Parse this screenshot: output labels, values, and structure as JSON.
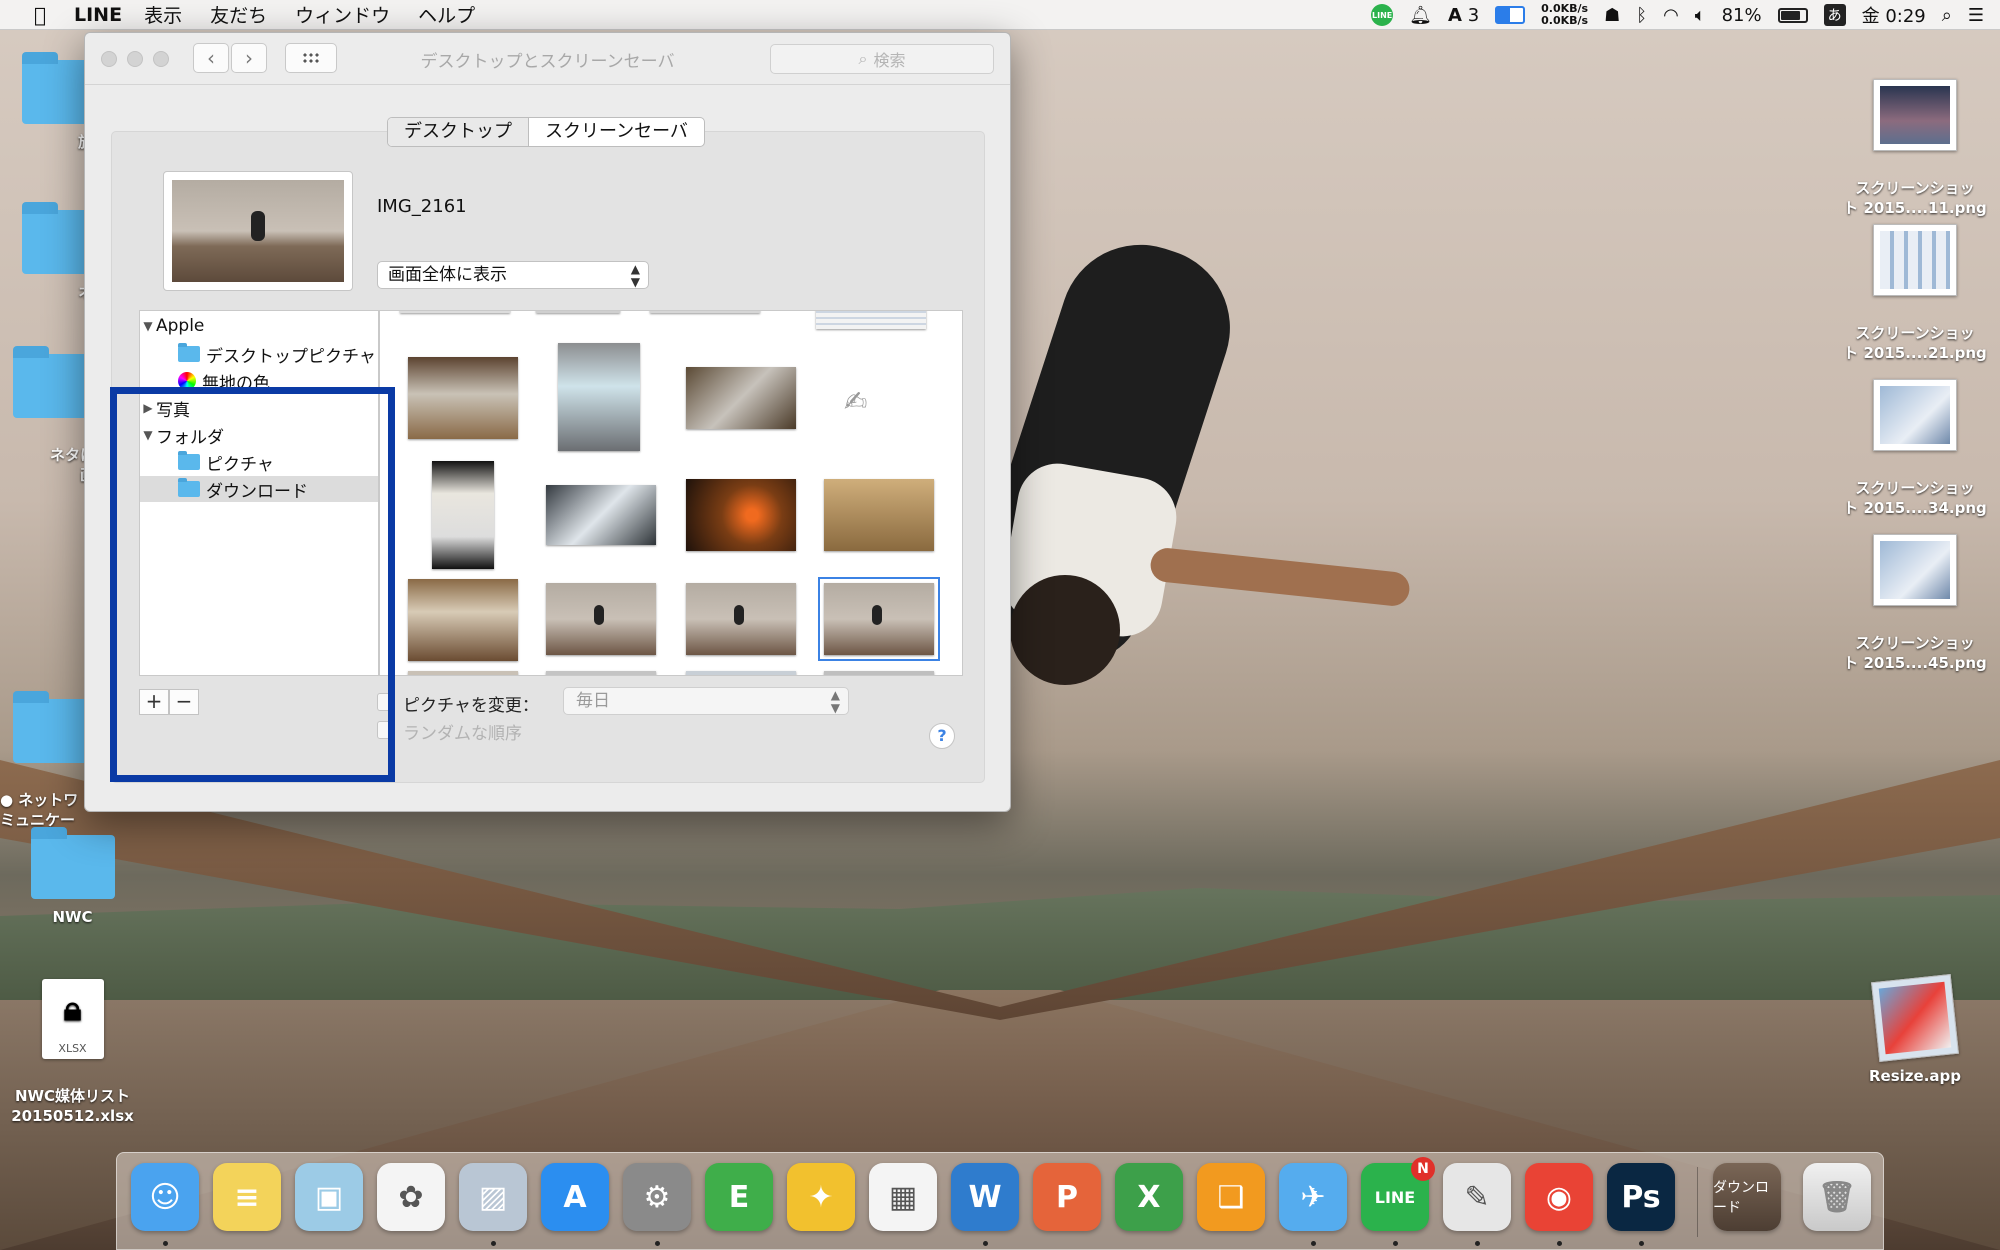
{
  "menubar": {
    "app_name": "LINE",
    "menus": [
      "表示",
      "友だち",
      "ウィンドウ",
      "ヘルプ"
    ],
    "status": {
      "line_icon_text": "LINE",
      "adobe_count": "3",
      "net_up": "0.0KB/s",
      "net_down": "0.0KB/s",
      "battery_percent": "81%",
      "battery_level": 0.81,
      "ime": "あ",
      "clock": "金 0:29"
    }
  },
  "desktop_left": [
    {
      "label": "旅ガ"
    },
    {
      "label": "オク"
    },
    {
      "label": "ネタにな\n画像"
    },
    {
      "label": "● ネットワ\nミュニケー"
    },
    {
      "label": "NWC"
    },
    {
      "label": "NWC媒体リスト\n20150512.xlsx",
      "ext": "XLSX"
    }
  ],
  "desktop_right": [
    {
      "label": "スクリーンショッ\nト 2015....11.png"
    },
    {
      "label": "スクリーンショッ\nト 2015....21.png"
    },
    {
      "label": "スクリーンショッ\nト 2015....34.png"
    },
    {
      "label": "スクリーンショッ\nト 2015....45.png"
    },
    {
      "label": "Resize.app"
    }
  ],
  "window": {
    "title": "デスクトップとスクリーンセーバ",
    "search_placeholder": "検索",
    "tabs": [
      {
        "label": "デスクトップ",
        "selected": true
      },
      {
        "label": "スクリーンセーバ",
        "selected": false
      }
    ],
    "current_image_name": "IMG_2161",
    "fit_option": "画面全体に表示",
    "sources": [
      {
        "label": "Apple",
        "type": "group",
        "expanded": true
      },
      {
        "label": "デスクトップピクチャ",
        "type": "folder"
      },
      {
        "label": "無地の色",
        "type": "colors"
      },
      {
        "label": "写真",
        "type": "group",
        "expanded": false
      },
      {
        "label": "フォルダ",
        "type": "group",
        "expanded": true
      },
      {
        "label": "ピクチャ",
        "type": "folder"
      },
      {
        "label": "ダウンロード",
        "type": "folder",
        "selected": true
      }
    ],
    "add_button": "+",
    "remove_button": "−",
    "change_picture_label": "ピクチャを変更：",
    "interval": "毎日",
    "random_order_label": "ランダムな順序",
    "help_label": "?"
  },
  "dock": {
    "apps": [
      {
        "name": "Finder",
        "glyph": "☺",
        "color": "#4aa3ef",
        "running": true
      },
      {
        "name": "Notes",
        "glyph": "≡",
        "color": "#f3d35a",
        "running": false
      },
      {
        "name": "Preview",
        "glyph": "▣",
        "color": "#9ccbe6",
        "running": false
      },
      {
        "name": "Photos",
        "glyph": "✿",
        "color": "#f4f4f4",
        "running": false
      },
      {
        "name": "Resize",
        "glyph": "▨",
        "color": "#b9c6d4",
        "running": true
      },
      {
        "name": "App Store",
        "glyph": "A",
        "color": "#2b8ef0",
        "running": false
      },
      {
        "name": "System Preferences",
        "glyph": "⚙",
        "color": "#8a8a8a",
        "running": true
      },
      {
        "name": "Evernote",
        "glyph": "E",
        "color": "#3fae4a",
        "running": false
      },
      {
        "name": "Tips",
        "glyph": "✦",
        "color": "#f2c12e",
        "running": false
      },
      {
        "name": "Launchpad",
        "glyph": "▦",
        "color": "#f4f4f4",
        "running": false
      },
      {
        "name": "Word",
        "glyph": "W",
        "color": "#2f7ccd",
        "running": true
      },
      {
        "name": "PowerPoint",
        "glyph": "P",
        "color": "#e5643a",
        "running": false
      },
      {
        "name": "Excel",
        "glyph": "X",
        "color": "#3da04a",
        "running": false
      },
      {
        "name": "iBooks",
        "glyph": "❑",
        "color": "#f29a1f",
        "running": false
      },
      {
        "name": "Twitter",
        "glyph": "✈",
        "color": "#55acee",
        "running": true
      },
      {
        "name": "LINE",
        "glyph": "LINE",
        "color": "#2bb24c",
        "running": true,
        "badge": "N"
      },
      {
        "name": "Script Editor",
        "glyph": "✎",
        "color": "#e6e6e6",
        "running": true
      },
      {
        "name": "Chrome",
        "glyph": "◉",
        "color": "#e94335",
        "running": true
      },
      {
        "name": "Photoshop",
        "glyph": "Ps",
        "color": "#0a2742",
        "running": true
      }
    ],
    "stack_label": "ダウンロード",
    "trash_label": "Trash"
  },
  "colors": {
    "selection_blue": "#3b82e4",
    "annotation_blue": "#0a3aa5"
  }
}
